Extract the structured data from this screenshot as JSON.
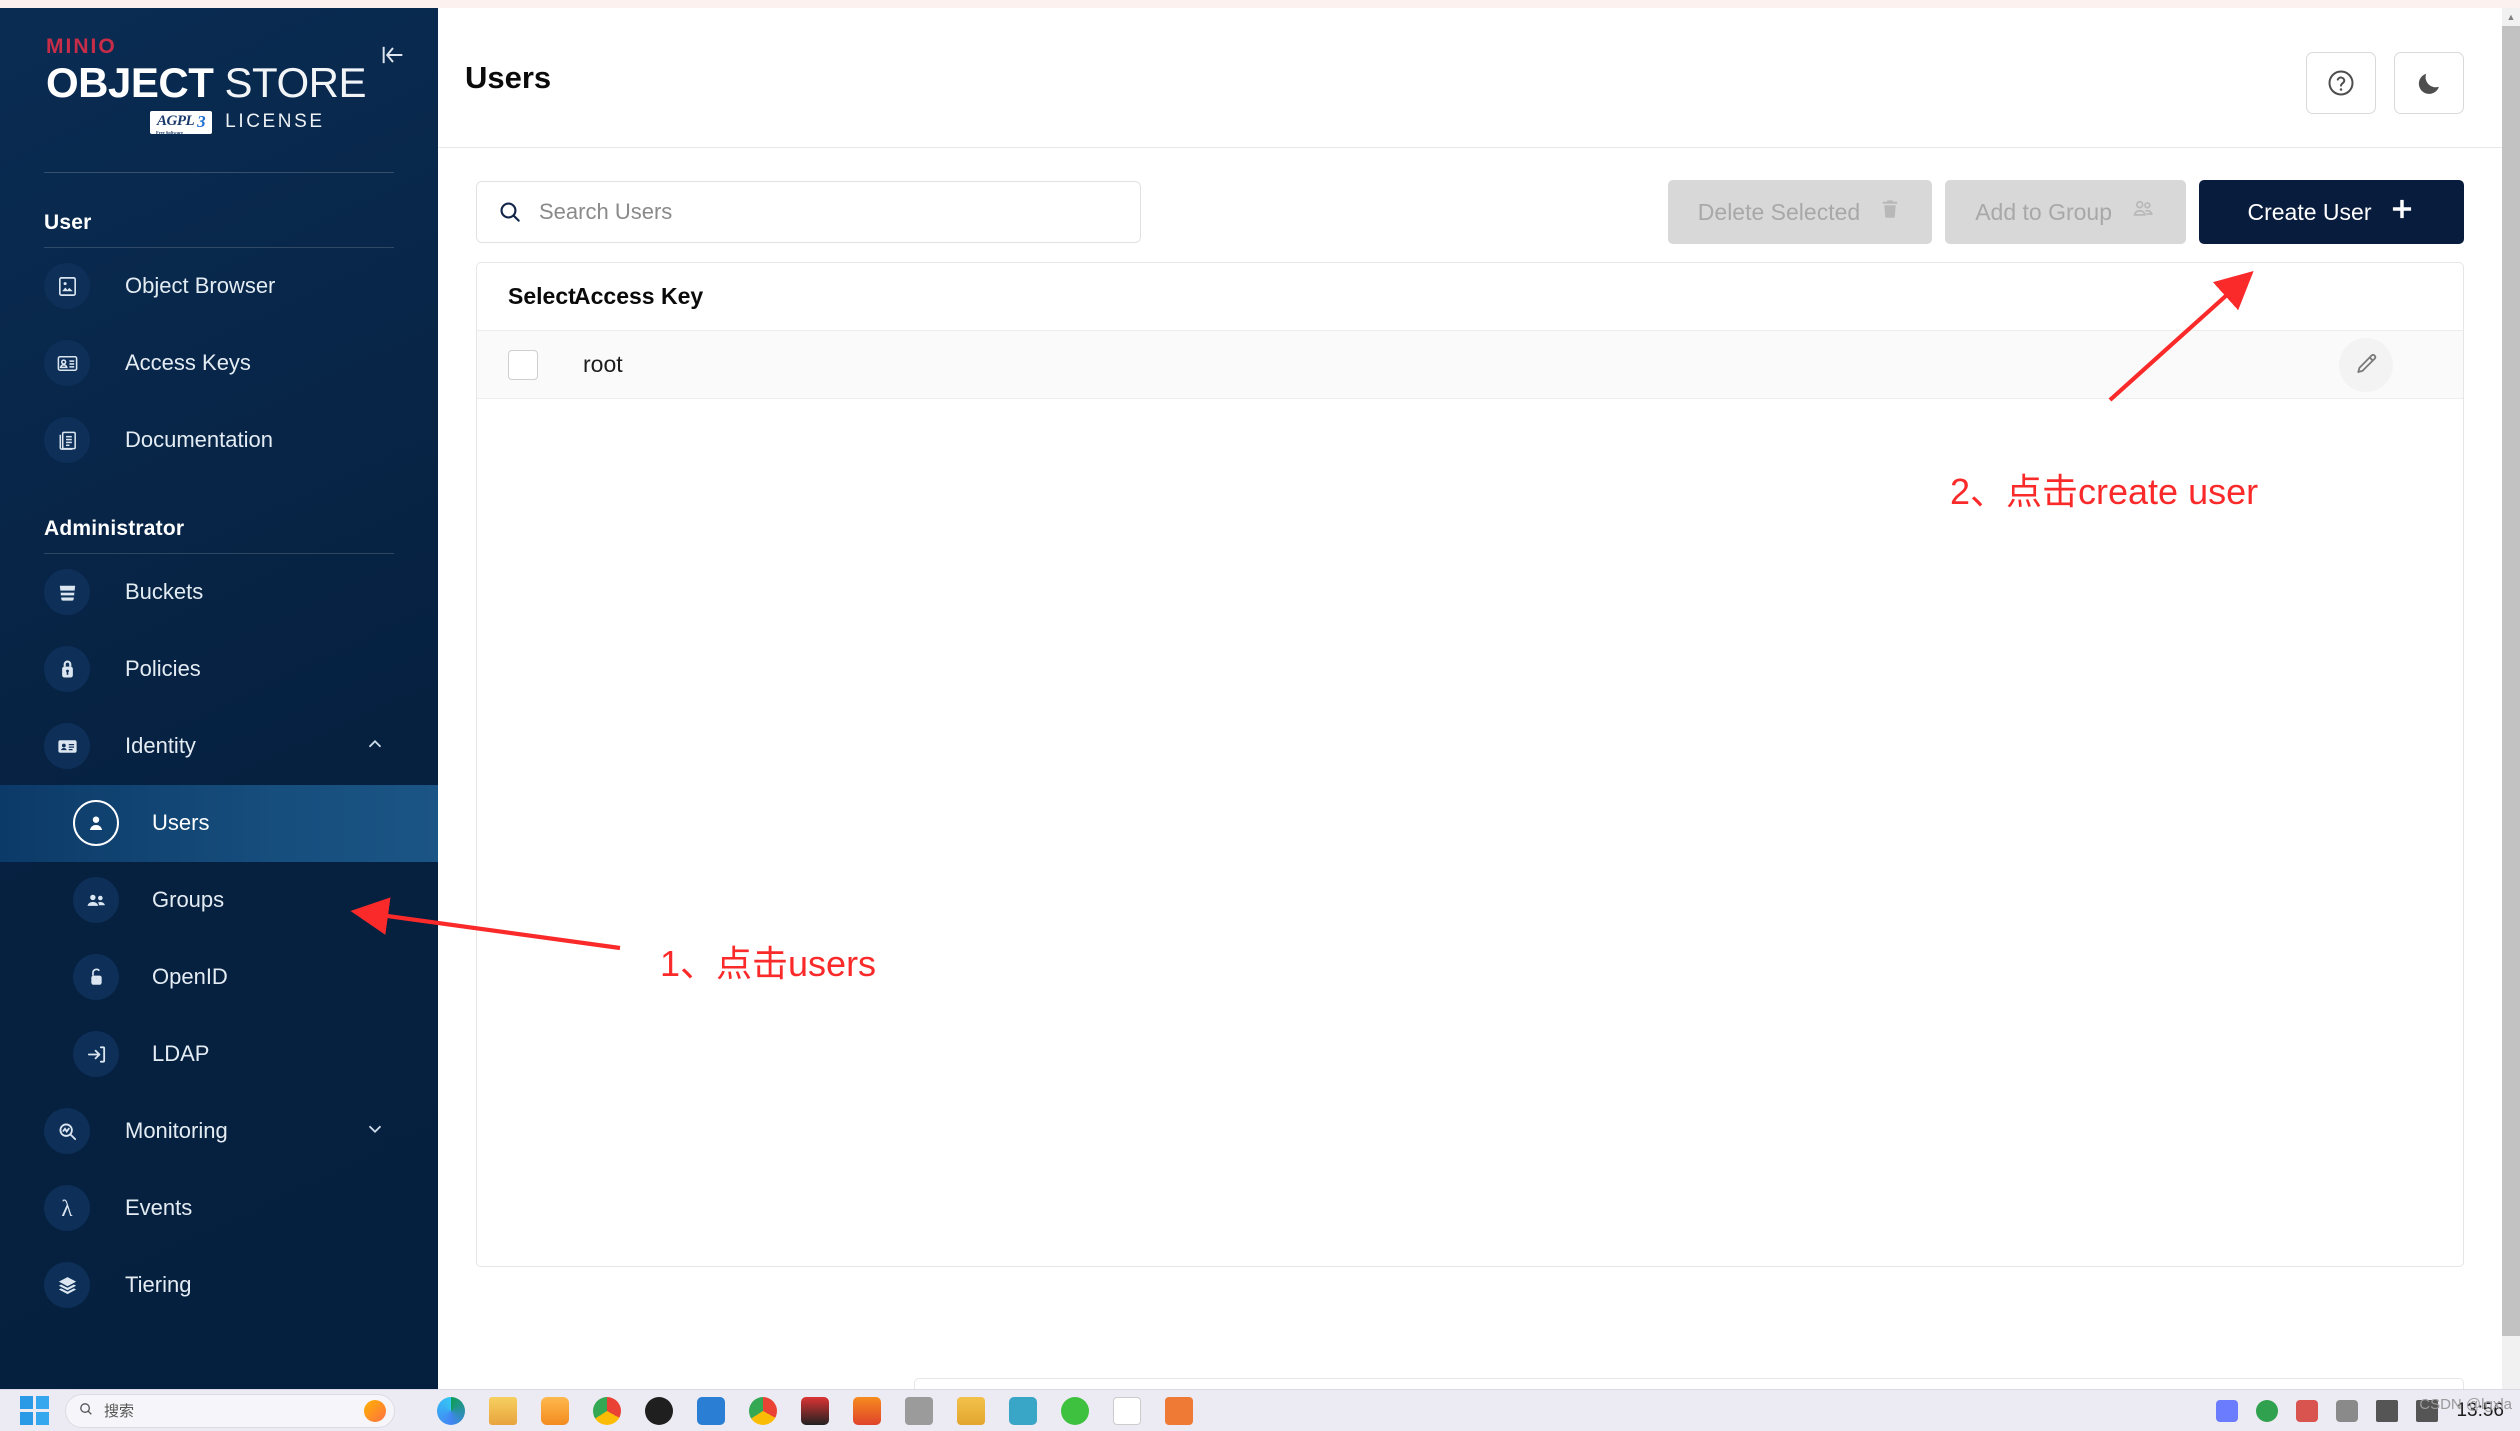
{
  "brand": {
    "minio": "MINIO",
    "object": "OBJECT",
    "store": "STORE",
    "agpl": "AGPL",
    "agpl_sub": "Free Software",
    "license": "LICENSE",
    "collapse_icon": "collapse-sidebar-icon"
  },
  "sidebar": {
    "accent_color": "#c72c48",
    "background_color": "#06203f",
    "active_color": "#17507f",
    "sections": [
      {
        "label": "User",
        "items": [
          {
            "label": "Object Browser",
            "icon": "object-browser-icon",
            "active": false
          },
          {
            "label": "Access Keys",
            "icon": "access-keys-icon",
            "active": false
          },
          {
            "label": "Documentation",
            "icon": "documentation-icon",
            "active": false
          }
        ]
      },
      {
        "label": "Administrator",
        "items": [
          {
            "label": "Buckets",
            "icon": "bucket-icon",
            "active": false
          },
          {
            "label": "Policies",
            "icon": "lock-icon",
            "active": false
          },
          {
            "label": "Identity",
            "icon": "identity-card-icon",
            "active": false,
            "expanded": true,
            "chevron": "chevron-up-icon"
          },
          {
            "label": "Users",
            "icon": "user-icon",
            "active": true,
            "sub": true
          },
          {
            "label": "Groups",
            "icon": "groups-icon",
            "active": false,
            "sub": true
          },
          {
            "label": "OpenID",
            "icon": "openid-unlock-icon",
            "active": false,
            "sub": true
          },
          {
            "label": "LDAP",
            "icon": "ldap-login-icon",
            "active": false,
            "sub": true
          },
          {
            "label": "Monitoring",
            "icon": "monitoring-icon",
            "active": false,
            "expanded": false,
            "chevron": "chevron-down-icon"
          },
          {
            "label": "Events",
            "icon": "lambda-icon",
            "active": false
          },
          {
            "label": "Tiering",
            "icon": "tiering-layers-icon",
            "active": false
          }
        ]
      }
    ]
  },
  "header": {
    "title": "Users",
    "help_icon": "help-circle-icon",
    "theme_icon": "dark-mode-moon-icon"
  },
  "toolbar": {
    "search_placeholder": "Search Users",
    "search_value": "",
    "search_icon": "search-icon",
    "delete_selected_label": "Delete Selected",
    "delete_selected_icon": "trash-icon",
    "delete_selected_disabled": true,
    "add_to_group_label": "Add to Group",
    "add_to_group_icon": "group-add-icon",
    "add_to_group_disabled": true,
    "create_user_label": "Create User",
    "create_user_icon": "plus-icon",
    "create_user_color": "#081c3d"
  },
  "table": {
    "columns": [
      "Select",
      "Access Key"
    ],
    "rows": [
      {
        "selected": false,
        "access_key": "root",
        "edit_icon": "pencil-edit-icon"
      }
    ]
  },
  "annotations": {
    "color": "#fb2a2a",
    "items": [
      {
        "text": "1、点击users",
        "target": "sidebar-item-users"
      },
      {
        "text": "2、点击create user",
        "target": "create-user-button"
      }
    ]
  },
  "taskbar": {
    "start_icon": "windows-start-icon",
    "search_placeholder": "搜索",
    "search_icon": "taskbar-search-icon",
    "clock": "13:56",
    "watermark": "CSDN @lgxla"
  }
}
